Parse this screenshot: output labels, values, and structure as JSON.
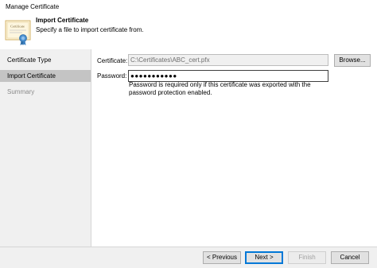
{
  "window": {
    "title": "Manage Certificate"
  },
  "header": {
    "title": "Import Certificate",
    "subtitle": "Specify a file to import certificate from.",
    "icon": "certificate-icon",
    "icon_text": "Certificate"
  },
  "steps": [
    {
      "label": "Certificate Type",
      "state": "normal"
    },
    {
      "label": "Import Certificate",
      "state": "active"
    },
    {
      "label": "Summary",
      "state": "disabled"
    }
  ],
  "form": {
    "certificate_label": "Certificate:",
    "certificate_value": "C:\\Certificates\\ABC_cert.pfx",
    "browse_label": "Browse...",
    "password_label": "Password:",
    "password_value": "●●●●●●●●●●●",
    "hint": "Password is required only if this certificate was exported with the password protection enabled."
  },
  "buttons": {
    "previous": "< Previous",
    "next": "Next >",
    "finish": "Finish",
    "cancel": "Cancel"
  },
  "colors": {
    "accent": "#0078d7",
    "sidebar_bg": "#f0f0f0",
    "active_step_bg": "#c4c4c4"
  }
}
